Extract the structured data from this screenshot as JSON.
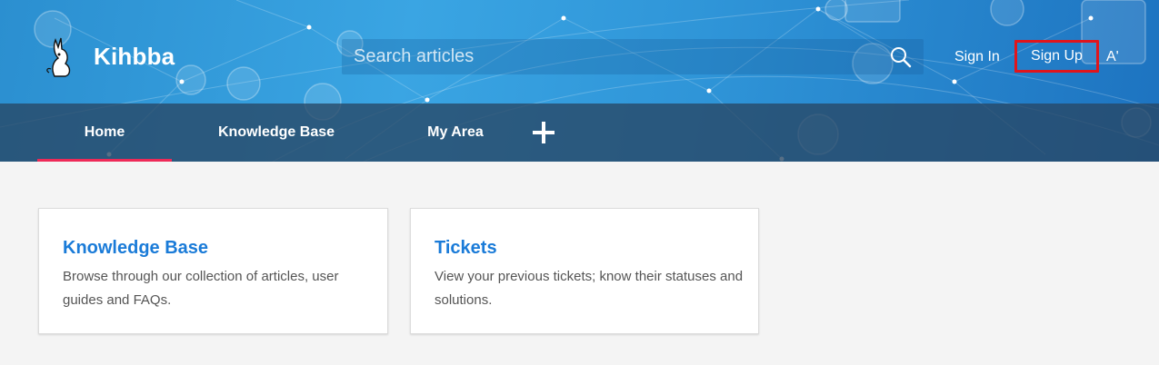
{
  "header": {
    "brand": "Kihbba",
    "search_placeholder": "Search articles",
    "signin_label": "Sign In",
    "signup_label": "Sign Up",
    "lang_label": "A'",
    "logo_icon": "kangaroo-logo-icon",
    "search_icon": "search-icon"
  },
  "nav": {
    "tabs": [
      {
        "label": "Home",
        "active": true
      },
      {
        "label": "Knowledge Base",
        "active": false
      },
      {
        "label": "My Area",
        "active": false
      }
    ],
    "add_icon": "plus-icon"
  },
  "cards": [
    {
      "title": "Knowledge Base",
      "description": "Browse through our collection of articles, user guides and FAQs."
    },
    {
      "title": "Tickets",
      "description": "View your previous tickets; know their statuses and solutions."
    }
  ],
  "colors": {
    "accent_link": "#1a7bd8",
    "active_tab_underline": "#ee2a58",
    "highlight_border": "#e0151c"
  }
}
